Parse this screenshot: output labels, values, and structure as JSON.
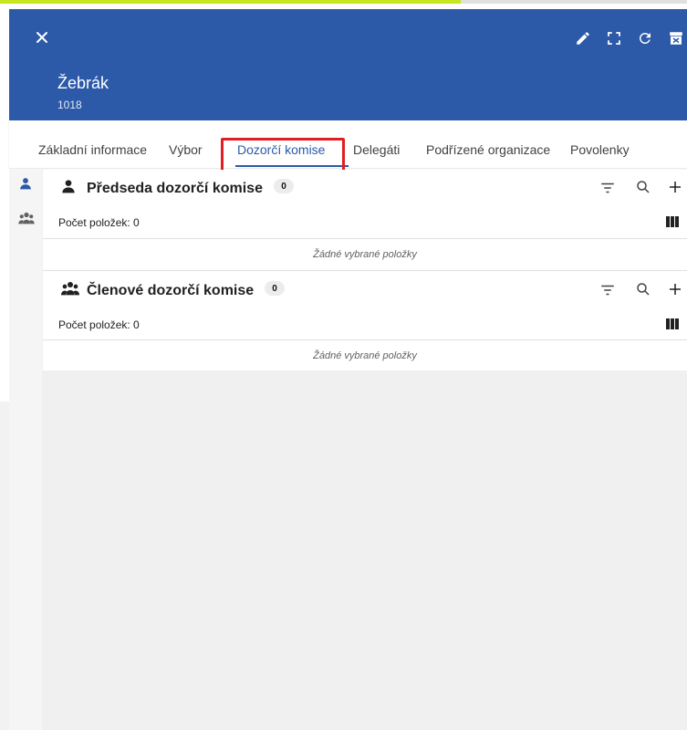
{
  "progress": {
    "fraction": 0.67,
    "color": "#c6e61e"
  },
  "header": {
    "title": "Žebrák",
    "subtitle": "1018",
    "background": "#2c5aa8",
    "actions": [
      "edit-icon",
      "expand-icon",
      "refresh-icon",
      "archive-icon"
    ]
  },
  "tabs": [
    {
      "label": "Základní informace"
    },
    {
      "label": "Výbor"
    },
    {
      "label": "Dozorčí komise",
      "active": true
    },
    {
      "label": "Delegáti"
    },
    {
      "label": "Podřízené organizace"
    },
    {
      "label": "Povolenky"
    }
  ],
  "highlight_color": "#e01e24",
  "panels": [
    {
      "title": "Předseda dozorčí komise",
      "badge": "0",
      "count_label": "Počet položek: 0",
      "empty_label": "Žádné vybrané položky"
    },
    {
      "title": "Členové dozorčí komise",
      "badge": "0",
      "count_label": "Počet položek: 0",
      "empty_label": "Žádné vybrané položky"
    }
  ]
}
